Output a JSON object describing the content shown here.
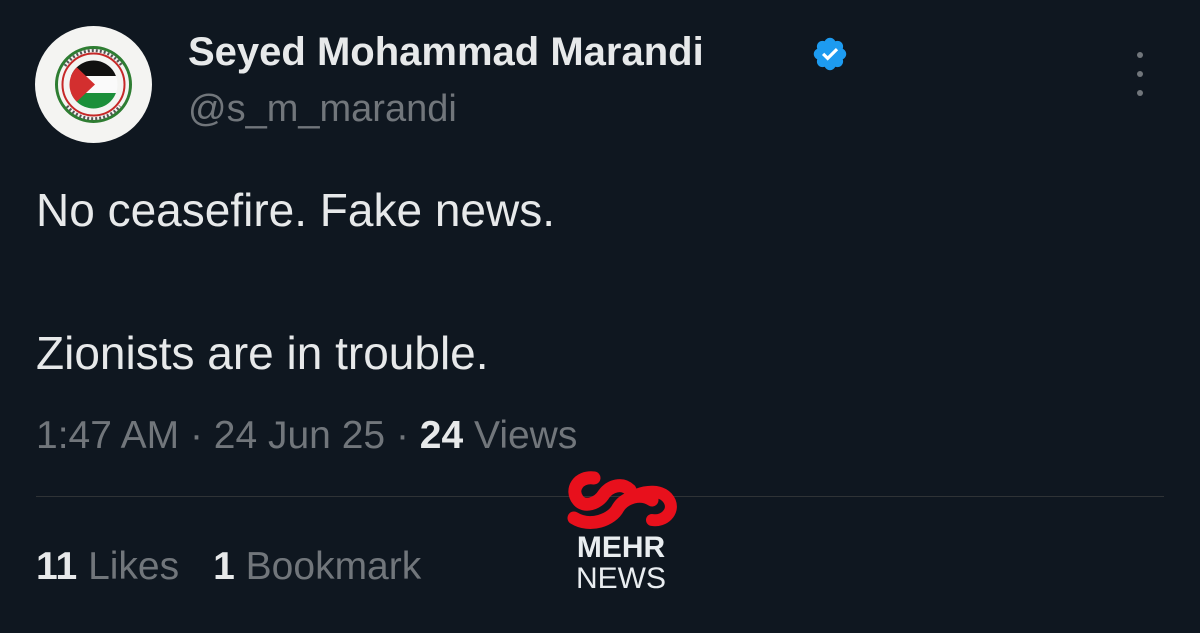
{
  "tweet": {
    "author": {
      "display_name": "Seyed Mohammad Marandi",
      "handle": "@s_m_marandi",
      "verified_icon": "verified-badge-icon",
      "avatar_icon": "palestine-flag-emblem"
    },
    "text_line_1": "No ceasefire. Fake news.",
    "text_line_2": "Zionists are in trouble.",
    "meta": {
      "time": "1:47 AM",
      "separator": "·",
      "date": "24 Jun 25",
      "views_count": "24",
      "views_label": "Views"
    },
    "stats": {
      "likes_count": "11",
      "likes_label": "Likes",
      "bookmarks_count": "1",
      "bookmarks_label": "Bookmark"
    },
    "more_icon": "more-options-icon"
  },
  "watermark": {
    "line1": "MEHR",
    "line2": "NEWS",
    "color": "#e8101c"
  },
  "colors": {
    "background": "#0f1720",
    "primary_text": "#e7e9ea",
    "secondary_text": "#71767b",
    "verified": "#1d9bf0"
  }
}
